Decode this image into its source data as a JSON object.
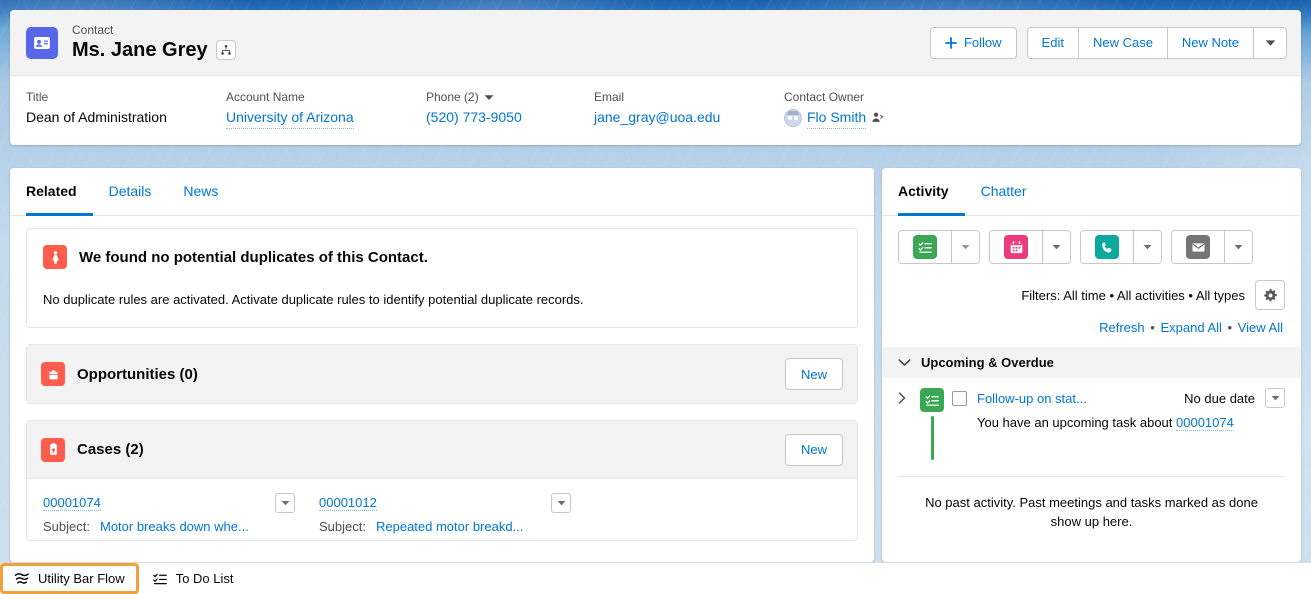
{
  "highlights": {
    "entity_icon": "contact-icon",
    "eyebrow": "Contact",
    "record_name": "Ms. Jane Grey",
    "hierarchy_icon": "hierarchy-icon",
    "actions": {
      "follow": "Follow",
      "edit": "Edit",
      "new_case": "New Case",
      "new_note": "New Note",
      "more_icon": "chevron-down-icon"
    },
    "fields": [
      {
        "label": "Title",
        "value": "Dean of Administration",
        "type": "text"
      },
      {
        "label": "Account Name",
        "value": "University of Arizona",
        "type": "link"
      },
      {
        "label": "Phone (2)",
        "value": "(520) 773-9050",
        "type": "link",
        "has_caret": true
      },
      {
        "label": "Email",
        "value": "jane_gray@uoa.edu",
        "type": "link"
      },
      {
        "label": "Contact Owner",
        "value": "Flo Smith",
        "type": "owner"
      }
    ]
  },
  "left_panel": {
    "tabs": [
      {
        "label": "Related",
        "active": true
      },
      {
        "label": "Details",
        "active": false
      },
      {
        "label": "News",
        "active": false
      }
    ],
    "duplicates": {
      "icon": "duplicate-warning-icon",
      "title": "We found no potential duplicates of this Contact.",
      "body": "No duplicate rules are activated. Activate duplicate rules to identify potential duplicate records."
    },
    "opportunities": {
      "icon": "opportunity-icon",
      "title": "Opportunities (0)",
      "new_label": "New"
    },
    "cases": {
      "icon": "case-icon",
      "title": "Cases (2)",
      "new_label": "New",
      "subject_label": "Subject:",
      "rows": [
        {
          "number": "00001074",
          "subject": "Motor breaks down whe..."
        },
        {
          "number": "00001012",
          "subject": "Repeated motor breakd..."
        }
      ]
    }
  },
  "right_panel": {
    "tabs": [
      {
        "label": "Activity",
        "active": true
      },
      {
        "label": "Chatter",
        "active": false
      }
    ],
    "composer_buttons": [
      {
        "name": "new-task-button",
        "icon": "task-icon",
        "color": "#3ba755"
      },
      {
        "name": "new-event-button",
        "icon": "event-icon",
        "color": "#eb3b7d"
      },
      {
        "name": "log-a-call-button",
        "icon": "phone-icon",
        "color": "#0aa99e"
      },
      {
        "name": "email-button",
        "icon": "email-icon",
        "color": "#757575"
      }
    ],
    "filters_text": "Filters: All time • All activities • All types",
    "gear_icon": "gear-icon",
    "links": {
      "refresh": "Refresh",
      "expand_all": "Expand All",
      "view_all": "View All",
      "separator": "•"
    },
    "upcoming": {
      "section_title": "Upcoming & Overdue",
      "collapse_icon": "chevron-down-icon",
      "task": {
        "expand_icon": "chevron-right-icon",
        "icon": "task-icon",
        "subject": "Follow-up on stat...",
        "due": "No due date",
        "menu_icon": "chevron-down-icon",
        "detail_prefix": "You have an upcoming task about",
        "detail_link": "00001074"
      }
    },
    "no_past_activity": "No past activity. Past meetings and tasks marked as done show up here."
  },
  "utility_bar": {
    "items": [
      {
        "label": "Utility Bar Flow",
        "icon": "flow-icon",
        "focused": true
      },
      {
        "label": "To Do List",
        "icon": "todo-list-icon",
        "focused": false
      }
    ]
  },
  "colors": {
    "link": "#0176d3",
    "contact_icon": "#5867e8",
    "alert_orange": "#fe5c4c",
    "focus_orange": "#f2a03d",
    "task_green": "#3ba755",
    "event_pink": "#eb3b7d",
    "call_teal": "#0aa99e",
    "email_gray": "#757575"
  }
}
